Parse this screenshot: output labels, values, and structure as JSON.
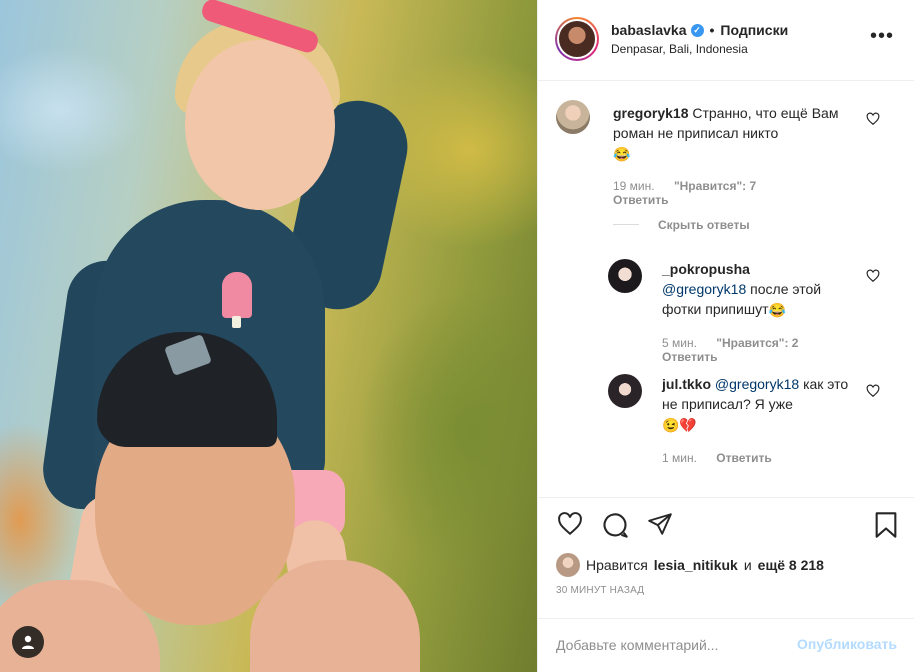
{
  "post": {
    "username": "babaslavka",
    "separator": "•",
    "follow_label": "Подписки",
    "location": "Denpasar, Bali, Indonesia",
    "more_icon": "more-horizontal-icon"
  },
  "comments": [
    {
      "username": "gregoryk18",
      "text": "Странно, что ещё Вам роман не приписал никто",
      "emoji": "😂",
      "time": "19 мин.",
      "likes": "\"Нравится\": 7",
      "reply_label": "Ответить",
      "hide_replies": "Скрыть ответы"
    },
    {
      "username": "_pokropusha",
      "mention": "@gregoryk18",
      "text": "после этой фотки припишут",
      "emoji": "😂",
      "time": "5 мин.",
      "likes": "\"Нравится\": 2",
      "reply_label": "Ответить"
    },
    {
      "username": "jul.tkko",
      "mention": "@gregoryk18",
      "text": "как это не приписал? Я уже",
      "emoji": "😉💔",
      "time": "1 мин.",
      "reply_label": "Ответить"
    }
  ],
  "likes": {
    "prefix": "Нравится",
    "user": "lesia_nitikuk",
    "conj": "и",
    "others": "ещё 8 218"
  },
  "timestamp": "30 МИНУТ НАЗАД",
  "comment_box": {
    "placeholder": "Добавьте комментарий...",
    "publish": "Опубликовать"
  },
  "colors": {
    "verified": "#3897f0",
    "mention": "#00376b",
    "muted": "#8e8e8e",
    "publish_disabled": "#b3dbff"
  }
}
